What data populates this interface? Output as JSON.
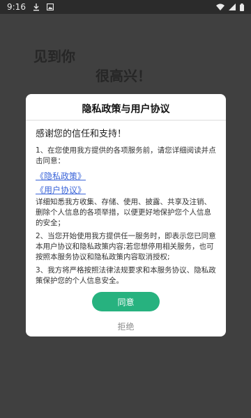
{
  "status_bar": {
    "time": "9:16",
    "icons": [
      "download-icon",
      "image-icon",
      "wifi-icon",
      "signal-icon",
      "battery-icon"
    ]
  },
  "background": {
    "line1": "见到你",
    "line2": "很高兴！"
  },
  "dialog": {
    "title": "隐私政策与用户协议",
    "greeting": "感谢您的信任和支持！",
    "para1": "1、在您使用我方提供的各项服务前，请您详细阅读并点击同意：",
    "privacy_link": "《隐私政策》",
    "user_agreement_link": "《用户协议》",
    "para2": "详细知悉我方收集、存储、使用、披露、共享及注销、删除个人信息的各项举措，以便更好地保护您个人信息的安全；",
    "para3": "2、当您开始使用我方提供任一服务时，即表示您已同意本用户协议和隐私政策内容;若您想停用相关服务，也可按照本服务协议和隐私政策内容取消授权;",
    "para4": "3、我方将严格按照法律法规要求和本服务协议、隐私政策保护您的个人信息安全。",
    "agree_label": "同意",
    "reject_label": "拒绝"
  },
  "colors": {
    "accent": "#27b27f",
    "link": "#3a64d8",
    "overlay": "#3a3a3a"
  }
}
